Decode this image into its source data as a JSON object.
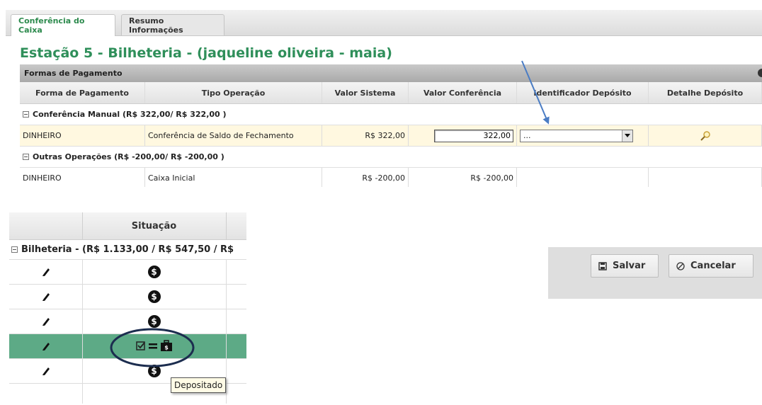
{
  "tabs": [
    {
      "label": "Conferência do Caixa",
      "active": true
    },
    {
      "label": "Resumo Informações",
      "active": false
    }
  ],
  "page_title": "Estação 5 - Bilheteria - (jaqueline oliveira - maia)",
  "grid": {
    "caption": "Formas de Pagamento",
    "columns": [
      "Forma de Pagamento",
      "Tipo Operação",
      "Valor Sistema",
      "Valor Conferência",
      "Identificador Depósito",
      "Detalhe Depósito"
    ],
    "groups": [
      {
        "label": "Conferência Manual (R$ 322,00/ R$ 322,00 )",
        "rows": [
          {
            "forma": "DINHEIRO",
            "tipo": "Conferência de Saldo de Fechamento",
            "valor_sistema": "R$ 322,00",
            "valor_conferencia": "322,00",
            "identificador": "...",
            "detail_icon": "magnifier-icon"
          }
        ]
      },
      {
        "label": "Outras Operações (R$ -200,00/ R$ -200,00 )",
        "rows": [
          {
            "forma": "DINHEIRO",
            "tipo": "Caixa Inicial",
            "valor_sistema": "R$ -200,00",
            "valor_conferencia": "R$ -200,00"
          }
        ]
      }
    ]
  },
  "status_panel": {
    "column": "Situação",
    "group_label": "Bilheteria - (R$ 1.133,00 / R$ 547,50 / R$",
    "rows": [
      {
        "edit_icon": "pencil-icon",
        "status_icon": "dollar-circle-icon",
        "highlight": false
      },
      {
        "edit_icon": "pencil-icon",
        "status_icon": "dollar-circle-icon",
        "highlight": false
      },
      {
        "edit_icon": "pencil-icon",
        "status_icon": "dollar-circle-icon",
        "highlight": false
      },
      {
        "edit_icon": "pencil-icon",
        "status_icon": "checkbox-equals-cash-icon",
        "highlight": true
      },
      {
        "edit_icon": "pencil-icon",
        "status_icon": "dollar-circle-icon",
        "highlight": false
      }
    ],
    "dollar_glyph": "$",
    "tooltip": "Depositado",
    "highlight_color": "#5daa86"
  },
  "actions": {
    "save_label": "Salvar",
    "cancel_label": "Cancelar",
    "save_icon": "save-icon",
    "cancel_icon": "cancel-icon"
  },
  "annotations": {
    "arrow_color": "#4a7cc4",
    "ellipse_color": "#1c2d4f"
  }
}
